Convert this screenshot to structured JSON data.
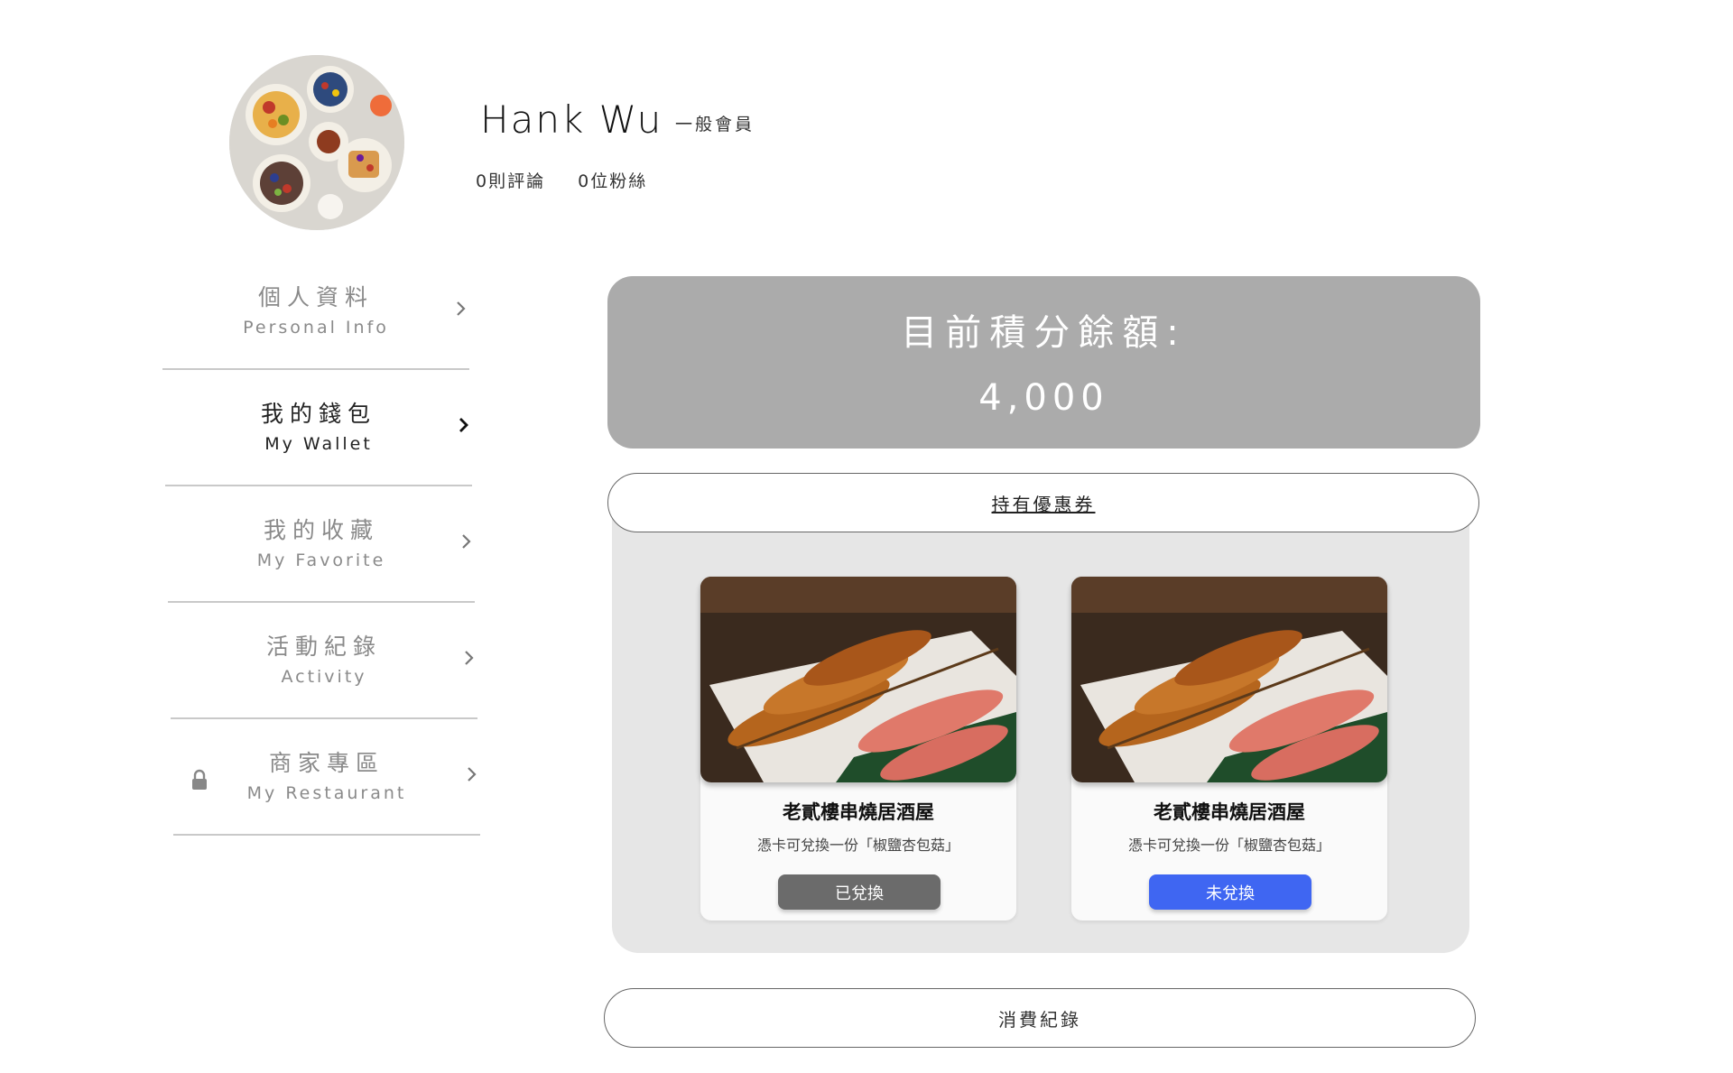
{
  "profile": {
    "name": "Hank Wu",
    "level": "一般會員",
    "reviews": "0則評論",
    "followers": "0位粉絲"
  },
  "sidebar": {
    "items": [
      {
        "zh": "個人資料",
        "en": "Personal Info"
      },
      {
        "zh": "我的錢包",
        "en": "My Wallet"
      },
      {
        "zh": "我的收藏",
        "en": "My Favorite"
      },
      {
        "zh": "活動紀錄",
        "en": "Activity"
      },
      {
        "zh": "商家專區",
        "en": "My Restaurant"
      }
    ]
  },
  "wallet": {
    "points_label": "目前積分餘額:",
    "points_value": "4,000",
    "coupons_tab": "持有優惠券",
    "history_button": "消費紀錄",
    "coupons": [
      {
        "title": "老貳樓串燒居酒屋",
        "desc": "憑卡可兌換一份「椒鹽杏包菇」",
        "status": "已兌換",
        "status_color": "#6b6b6b"
      },
      {
        "title": "老貳樓串燒居酒屋",
        "desc": "憑卡可兌換一份「椒鹽杏包菇」",
        "status": "未兌換",
        "status_color": "#3f66f2"
      }
    ]
  },
  "colors": {
    "accent_blue": "#3f66f2",
    "redeemed_gray": "#6b6b6b",
    "points_card": "#ababab",
    "coupon_area": "#e6e6e6"
  }
}
